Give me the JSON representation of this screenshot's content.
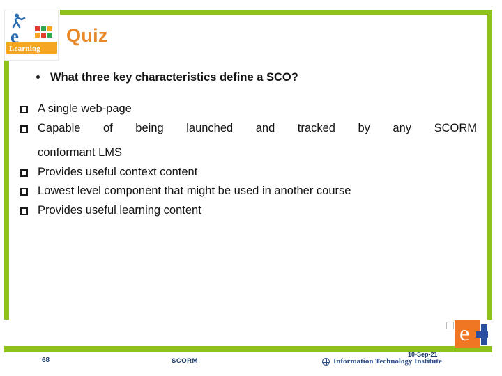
{
  "slide": {
    "title": "Quiz",
    "question": "What three key characteristics define a SCO?",
    "answers": [
      "A single web-page",
      "Capable of being launched and tracked by any SCORM conformant LMS",
      "Provides useful context content",
      "Lowest level component that might be used in another course",
      "Provides useful learning content"
    ],
    "answer2_line1": "Capable of being launched and tracked by any SCORM",
    "answer2_line2": "conformant LMS"
  },
  "logo": {
    "letter": "e",
    "word": "Learning",
    "name": "elearning-logo"
  },
  "footer": {
    "slide_number": "68",
    "center_label": "SCORM",
    "date": "10-Sep-21",
    "institute": "Information Technology Institute"
  },
  "brand": {
    "green": "#8ec11a",
    "orange": "#e8892b",
    "blue": "#2b4fa0",
    "footer_text": "#1a3a6b"
  }
}
